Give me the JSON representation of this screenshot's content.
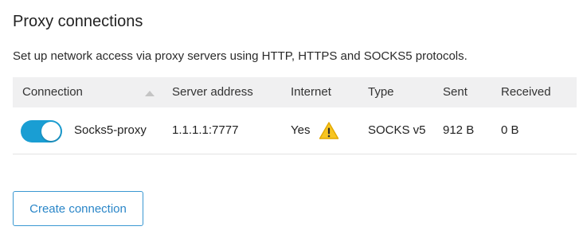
{
  "page": {
    "title": "Proxy connections",
    "description": "Set up network access via proxy servers using HTTP, HTTPS and SOCKS5 protocols."
  },
  "table": {
    "columns": [
      "Connection",
      "Server address",
      "Internet",
      "Type",
      "Sent",
      "Received"
    ],
    "sort_icon": "sort-ascending-icon",
    "rows": [
      {
        "enabled": true,
        "name": "Socks5-proxy",
        "server": "1.1.1.1:7777",
        "internet": "Yes",
        "internet_icon": "warning-icon",
        "type": "SOCKS v5",
        "sent": "912 B",
        "received": "0 B"
      }
    ]
  },
  "actions": {
    "create_label": "Create connection"
  },
  "colors": {
    "accent": "#1a9ed3",
    "warning": "#f7c521",
    "button_text": "#2a86c8"
  }
}
